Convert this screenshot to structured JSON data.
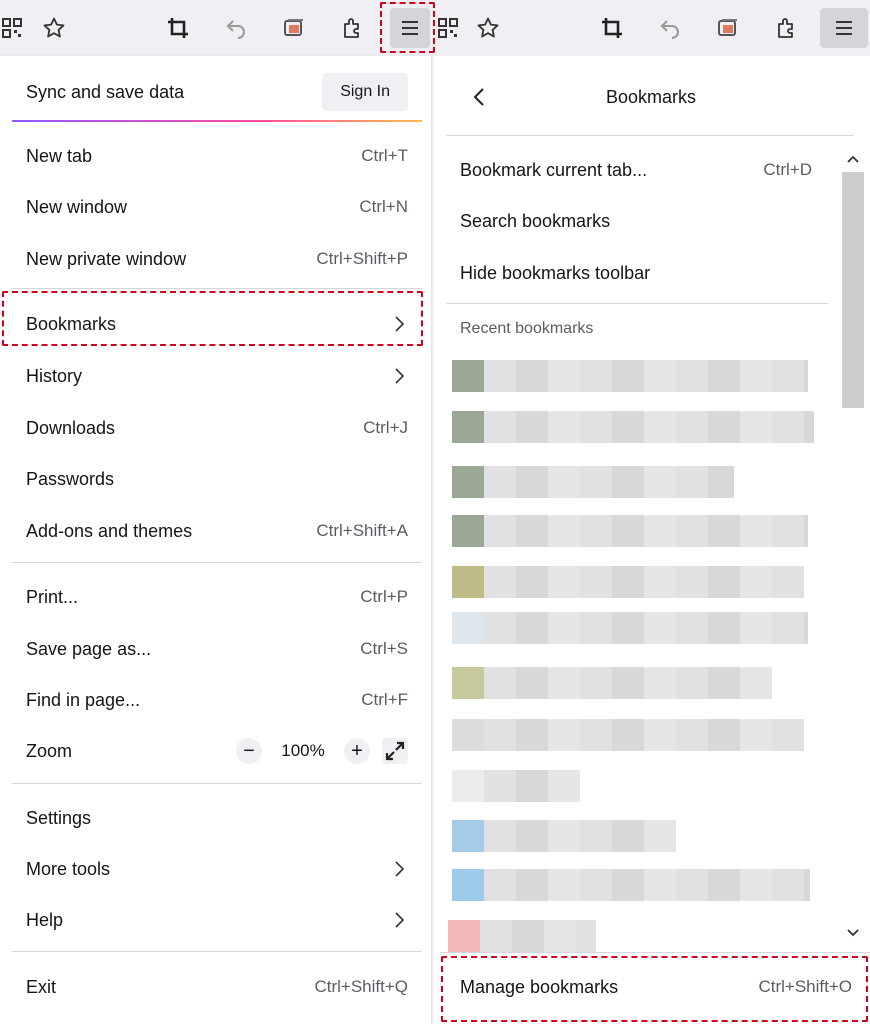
{
  "main_menu": {
    "sync_label": "Sync and save data",
    "sign_in_label": "Sign In",
    "items": [
      {
        "label": "New tab",
        "shortcut": "Ctrl+T"
      },
      {
        "label": "New window",
        "shortcut": "Ctrl+N"
      },
      {
        "label": "New private window",
        "shortcut": "Ctrl+Shift+P"
      },
      {
        "label": "Bookmarks",
        "shortcut": ""
      },
      {
        "label": "History",
        "shortcut": ""
      },
      {
        "label": "Downloads",
        "shortcut": "Ctrl+J"
      },
      {
        "label": "Passwords",
        "shortcut": ""
      },
      {
        "label": "Add-ons and themes",
        "shortcut": "Ctrl+Shift+A"
      },
      {
        "label": "Print...",
        "shortcut": "Ctrl+P"
      },
      {
        "label": "Save page as...",
        "shortcut": "Ctrl+S"
      },
      {
        "label": "Find in page...",
        "shortcut": "Ctrl+F"
      },
      {
        "label": "Zoom",
        "shortcut": ""
      },
      {
        "label": "Settings",
        "shortcut": ""
      },
      {
        "label": "More tools",
        "shortcut": ""
      },
      {
        "label": "Help",
        "shortcut": ""
      },
      {
        "label": "Exit",
        "shortcut": "Ctrl+Shift+Q"
      }
    ],
    "zoom": {
      "minus": "−",
      "value": "100%",
      "plus": "+"
    }
  },
  "bookmarks_panel": {
    "title": "Bookmarks",
    "items": [
      {
        "label": "Bookmark current tab...",
        "shortcut": "Ctrl+D"
      },
      {
        "label": "Search bookmarks",
        "shortcut": ""
      },
      {
        "label": "Hide bookmarks toolbar",
        "shortcut": ""
      }
    ],
    "recent_heading": "Recent bookmarks",
    "manage_label": "Manage bookmarks",
    "manage_shortcut": "Ctrl+Shift+O"
  },
  "colors": {
    "accent": "#d0021b",
    "toolbar_bg": "#f0f0f4",
    "favicon_colors": [
      "#9ba896",
      "#9ba896",
      "#9ba896",
      "#9ba896",
      "#bdbb86",
      "#dde6ec",
      "#c8c89e",
      "#dcdcdc",
      "#ececec",
      "#a6cbe9",
      "#9ccbeb",
      "#f0b8b8"
    ]
  },
  "icons": [
    "qr-code-icon",
    "star-icon",
    "crop-icon",
    "undo-icon",
    "picture-in-picture-icon",
    "extensions-icon",
    "hamburger-menu-icon",
    "chevron-right-icon",
    "chevron-left-icon",
    "fullscreen-icon",
    "scroll-up-icon",
    "scroll-down-icon"
  ]
}
